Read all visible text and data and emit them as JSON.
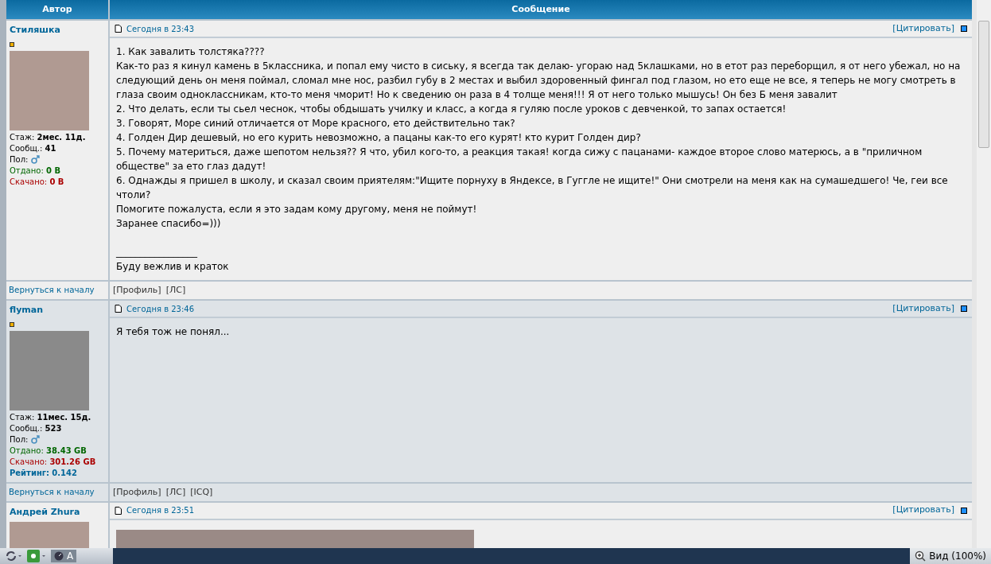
{
  "table": {
    "columns": [
      "Автор",
      "Сообщение"
    ]
  },
  "posts": [
    {
      "author": "Стиляшка",
      "rank": true,
      "stats": [
        {
          "kind": "plain",
          "label": "Стаж:",
          "value": "2мес. 11д."
        },
        {
          "kind": "plain",
          "label": "Сообщ.:",
          "value": "41"
        },
        {
          "kind": "gender",
          "label": "Пол:"
        },
        {
          "kind": "given",
          "label": "Отдано:",
          "value": "0 B"
        },
        {
          "kind": "taken",
          "label": "Скачано:",
          "value": "0 B"
        }
      ],
      "date": "Сегодня в 23:43",
      "quote": "[Цитировать]",
      "body": [
        {
          "kind": "text",
          "text": "1. Как завалить толстяка????"
        },
        {
          "kind": "text",
          "text": "Как-то раз я кинул камень в 5классника, и попал ему чисто в сиську, я всегда так делаю- угораю над 5клашками, но в етот раз переборщил, я от него убежал, но на следующий день он меня поймал, сломал мне нос, разбил губу в 2 местах и выбил здоровенный фингал под глазом, но ето еще не все, я теперь не могу смотреть в глаза своим одноклассникам, кто-то меня чморит! Но к сведению он раза в 4 толще меня!!! Я от него только мышусь! Он без Б меня завалит"
        },
        {
          "kind": "text",
          "text": "2. Что делать, если ты сьел чеснок, чтобы обдышать училку и класс, а когда я гуляю после уроков с девченкой, то запах остается!"
        },
        {
          "kind": "text",
          "text": "3. Говорят, Море синий отличается от Море красного, ето действительно так?"
        },
        {
          "kind": "text",
          "text": "4. Голден Дир дешевый, но его курить невозможно, а пацаны как-то его курят! кто курит Голден дир?"
        },
        {
          "kind": "text",
          "text": "5. Почему материться, даже шепотом нельзя?? Я что, убил кого-то, а реакция такая! когда сижу с пацанами- каждое второе слово матерюсь, а в \"приличном обществе\" за ето глаз дадут!"
        },
        {
          "kind": "text",
          "text": "6. Однажды я пришел в школу, и сказал своим приятелям:\"Ищите порнуху в Яндексе, в Гуггле не ищите!\" Они смотрели на меня как на сумашедшего! Че, геи все чтоли?"
        },
        {
          "kind": "text",
          "text": "Помогите пожалуста, если я это задам кому другому, меня не поймут!"
        },
        {
          "kind": "text",
          "text": "Заранее спасибо=)))"
        },
        {
          "kind": "signature",
          "text": "_________________"
        },
        {
          "kind": "text",
          "text": "Буду вежлив и краток"
        }
      ],
      "back": "Вернуться к началу",
      "links": [
        "[Профиль]",
        "[ЛС]"
      ]
    },
    {
      "author": "flyman",
      "rank": true,
      "stats": [
        {
          "kind": "plain",
          "label": "Стаж:",
          "value": "11мес. 15д."
        },
        {
          "kind": "plain",
          "label": "Сообщ.:",
          "value": "523"
        },
        {
          "kind": "gender",
          "label": "Пол:"
        },
        {
          "kind": "given",
          "label": "Отдано:",
          "value": "38.43 GB"
        },
        {
          "kind": "taken",
          "label": "Скачано:",
          "value": "301.26 GB"
        },
        {
          "kind": "rating",
          "label": "Рейтинг:",
          "value": "0.142"
        }
      ],
      "date": "Сегодня в 23:46",
      "quote": "[Цитировать]",
      "body": [
        {
          "kind": "text",
          "text": "Я тебя тож не понял..."
        }
      ],
      "back": "Вернуться к началу",
      "links": [
        "[Профиль]",
        "[ЛС]",
        "[ICQ]"
      ]
    },
    {
      "author": "Андрей Zhura",
      "rank": false,
      "date": "Сегодня в 23:51",
      "quote": "[Цитировать]",
      "body": [
        {
          "kind": "photo"
        }
      ]
    }
  ],
  "status_bar": {
    "language": "A",
    "zoom": "Вид (100%)"
  }
}
